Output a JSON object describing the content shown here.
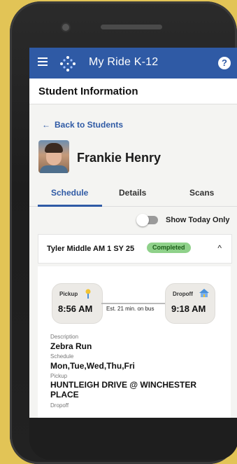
{
  "app": {
    "title": "My Ride K-12",
    "help": "?"
  },
  "section": {
    "title": "Student Information"
  },
  "back": {
    "label": "Back to Students",
    "arrow": "←"
  },
  "student": {
    "name": "Frankie Henry"
  },
  "tabs": [
    {
      "label": "Schedule",
      "active": true
    },
    {
      "label": "Details",
      "active": false
    },
    {
      "label": "Scans",
      "active": false
    }
  ],
  "toggle": {
    "label": "Show Today Only",
    "on": false
  },
  "route": {
    "name": "Tyler Middle AM 1 SY 25",
    "status": "Completed",
    "chevron": "^"
  },
  "trip": {
    "pickup_label": "Pickup",
    "pickup_time": "8:56 AM",
    "dropoff_label": "Dropoff",
    "dropoff_time": "9:18 AM",
    "estimate": "Est. 21 min. on bus"
  },
  "details": {
    "description_label": "Description",
    "description_value": "Zebra Run",
    "schedule_label": "Schedule",
    "schedule_value": "Mon,Tue,Wed,Thu,Fri",
    "pickup_label": "Pickup",
    "pickup_value": "HUNTLEIGH DRIVE @ WINCHESTER PLACE",
    "dropoff_label": "Dropoff"
  },
  "colors": {
    "accent": "#2f5aa5",
    "badge_bg": "#8fd18a",
    "background": "#e2c456"
  },
  "icons": [
    "menu-icon",
    "app-logo-icon",
    "help-icon",
    "back-arrow-icon",
    "chevron-up-icon",
    "pickup-pin-icon",
    "school-icon"
  ]
}
